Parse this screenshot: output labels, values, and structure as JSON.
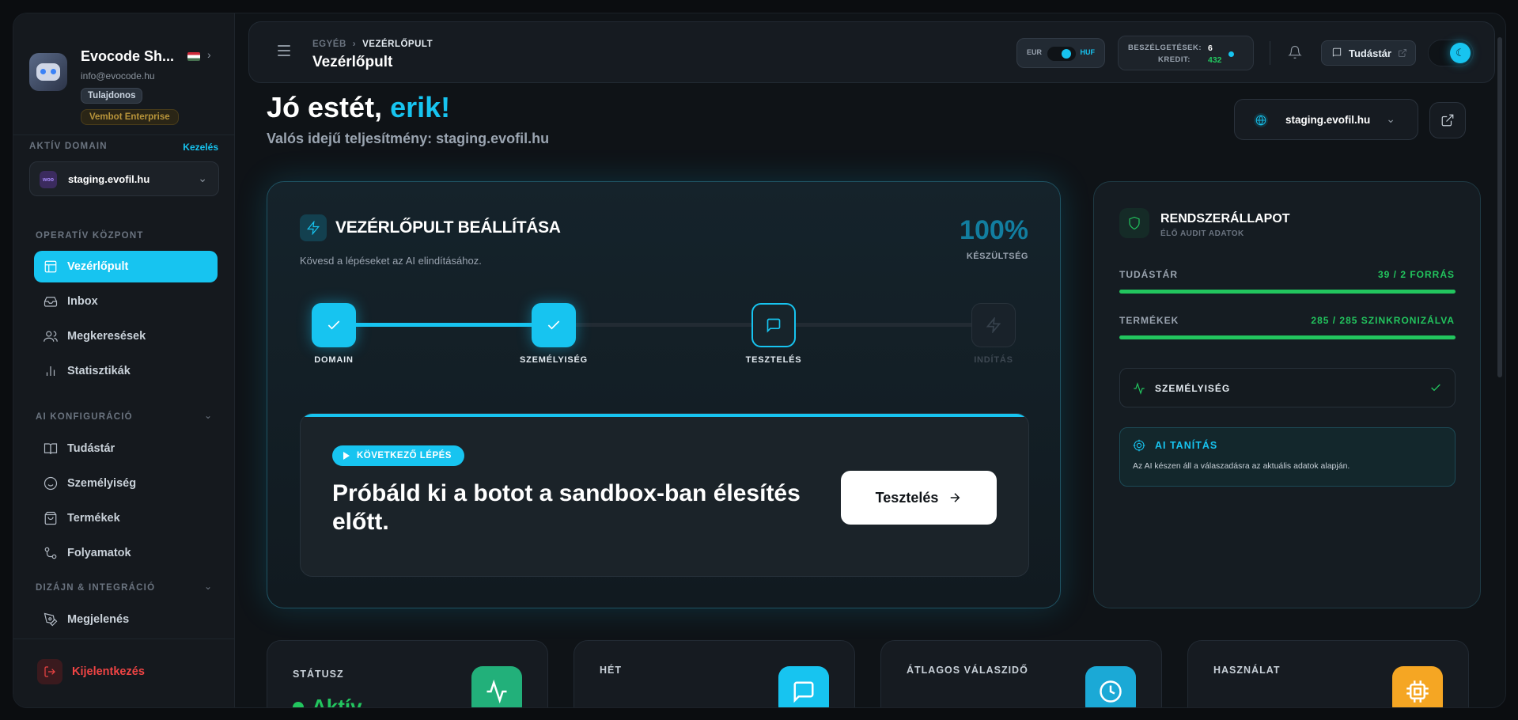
{
  "profile": {
    "name": "Evocode Sh...",
    "email": "info@evocode.hu",
    "role_badge": "Tulajdonos",
    "plan_badge": "Vembot Enterprise"
  },
  "domain_section": {
    "heading": "AKTÍV DOMAIN",
    "manage_link": "Kezelés",
    "logo_text": "woo",
    "selected_domain": "staging.evofil.hu"
  },
  "sidebar": {
    "sections": [
      {
        "heading": "OPERATÍV KÖZPONT"
      },
      {
        "heading": "AI KONFIGURÁCIÓ"
      },
      {
        "heading": "DIZÁJN & INTEGRÁCIÓ"
      }
    ],
    "items": [
      {
        "label": "Vezérlőpult",
        "icon": "layout-icon",
        "active": true
      },
      {
        "label": "Inbox",
        "icon": "inbox-icon"
      },
      {
        "label": "Megkeresések",
        "icon": "users-icon"
      },
      {
        "label": "Statisztikák",
        "icon": "bar-chart-icon"
      },
      {
        "label": "Tudástár",
        "icon": "book-icon"
      },
      {
        "label": "Személyiség",
        "icon": "smile-icon"
      },
      {
        "label": "Termékek",
        "icon": "shopping-bag-icon"
      },
      {
        "label": "Folyamatok",
        "icon": "workflow-icon"
      },
      {
        "label": "Megjelenés",
        "icon": "pen-tool-icon"
      }
    ],
    "logout_label": "Kijelentkezés"
  },
  "topbar": {
    "breadcrumb_parent": "EGYÉB",
    "breadcrumb_current": "VEZÉRLŐPULT",
    "page_title": "Vezérlőpult",
    "currency_left": "EUR",
    "currency_right": "HUF",
    "conversations_label": "BESZÉLGETÉSEK:",
    "conversations_value": "6",
    "credit_label": "KREDIT:",
    "credit_value": "432",
    "knowledge_button": "Tudástár"
  },
  "main": {
    "greeting_prefix": "Jó estét, ",
    "greeting_name": "erik!",
    "subtitle": "Valós idejű teljesítmény: staging.evofil.hu",
    "domain_pill": "staging.evofil.hu"
  },
  "setup": {
    "title": "VEZÉRLŐPULT BEÁLLÍTÁSA",
    "subtitle": "Kövesd a lépéseket az AI elindításához.",
    "percent": "100%",
    "percent_label": "KÉSZÜLTSÉG",
    "progress_fraction": 0.36,
    "steps": [
      {
        "label": "DOMAIN",
        "state": "done"
      },
      {
        "label": "SZEMÉLYISÉG",
        "state": "done"
      },
      {
        "label": "TESZTELÉS",
        "state": "current"
      },
      {
        "label": "INDÍTÁS",
        "state": "pending"
      }
    ],
    "next_badge": "KÖVETKEZŐ LÉPÉS",
    "next_title": "Próbáld ki a botot a sandbox-ban élesítés előtt.",
    "next_button": "Tesztelés"
  },
  "system": {
    "title": "RENDSZERÁLLAPOT",
    "subtitle": "ÉLŐ AUDIT ADATOK",
    "metrics": [
      {
        "label": "TUDÁSTÁR",
        "value": "39 / 2 FORRÁS",
        "fill": 1.0
      },
      {
        "label": "TERMÉKEK",
        "value": "285 / 285 SZINKRONIZÁLVA",
        "fill": 1.0
      }
    ],
    "personality_row": "SZEMÉLYISÉG",
    "ai_training_title": "AI TANÍTÁS",
    "ai_training_desc": "Az AI készen áll a válaszadásra az aktuális adatok alapján."
  },
  "kpis": [
    {
      "label": "STÁTUSZ",
      "value": "Aktív",
      "icon": "activity-icon",
      "color": "#22b07a"
    },
    {
      "label": "HÉT",
      "value": "",
      "icon": "message-square-icon",
      "color": "#17c4f0"
    },
    {
      "label": "ÁTLAGOS VÁLASZIDŐ",
      "value": "",
      "icon": "clock-icon",
      "color": "#1ba9d6"
    },
    {
      "label": "HASZNÁLAT",
      "value": "",
      "icon": "cpu-icon",
      "color": "#f5a623"
    }
  ],
  "colors": {
    "accent": "#17c4f0",
    "success": "#22c55e",
    "danger": "#ef4444",
    "warning": "#f5a623"
  }
}
